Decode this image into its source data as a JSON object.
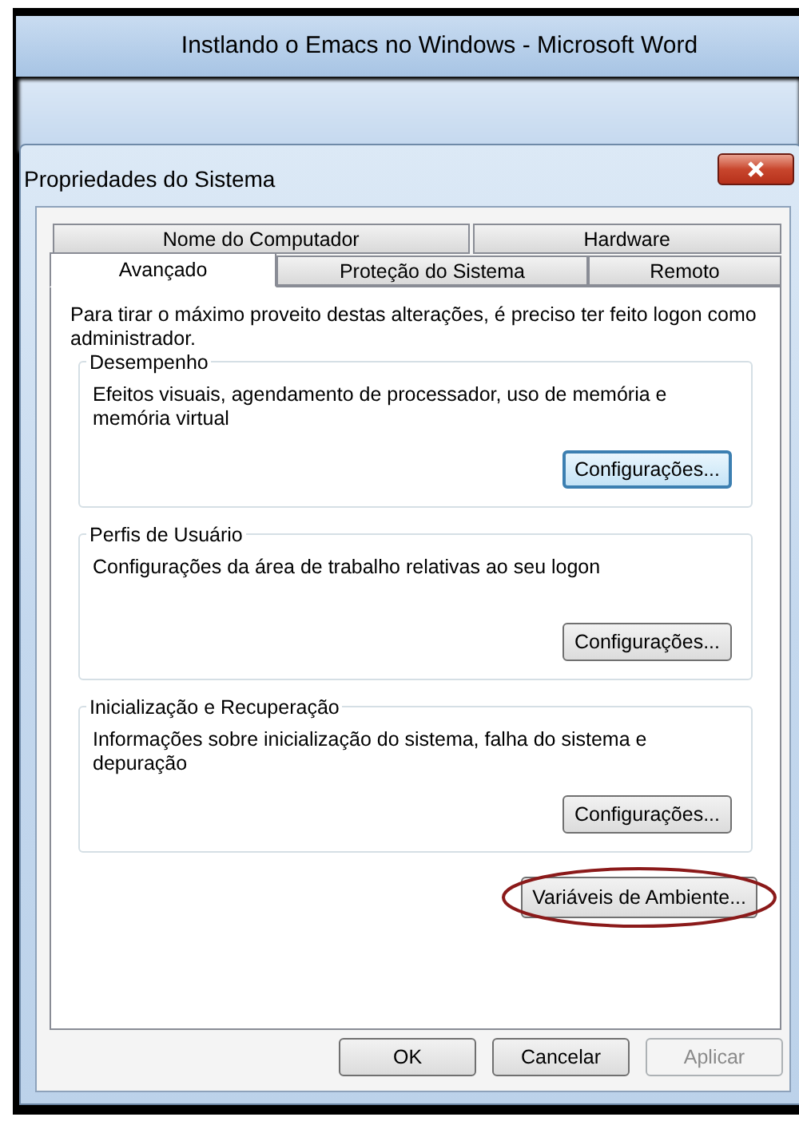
{
  "word_window": {
    "title": "Instlando o Emacs no Windows  -  Microsoft Word"
  },
  "dialog": {
    "title": "Propriedades do Sistema"
  },
  "tab_rows": [
    {
      "tabs": [
        {
          "label": "Nome do Computador",
          "selected": false
        },
        {
          "label": "Hardware",
          "selected": false
        }
      ]
    },
    {
      "tabs": [
        {
          "label": "Avançado",
          "selected": true
        },
        {
          "label": "Proteção do Sistema",
          "selected": false
        },
        {
          "label": "Remoto",
          "selected": false
        }
      ]
    }
  ],
  "notice": "Para tirar o máximo proveito destas alterações, é preciso ter feito logon como administrador.",
  "groups": [
    {
      "title": "Desempenho",
      "description": "Efeitos visuais, agendamento de processador, uso de memória e memória virtual",
      "button": {
        "label": "Configurações...",
        "focused": true
      }
    },
    {
      "title": "Perfis de Usuário",
      "description": "Configurações da área de trabalho relativas ao seu logon",
      "button": {
        "label": "Configurações...",
        "focused": false
      }
    },
    {
      "title": "Inicialização e Recuperação",
      "description": "Informações sobre inicialização do sistema, falha do sistema e depuração",
      "button": {
        "label": "Configurações...",
        "focused": false
      }
    }
  ],
  "environment_button": {
    "label": "Variáveis de Ambiente...",
    "highlighted": true
  },
  "buttons": [
    {
      "label": "OK",
      "disabled": false
    },
    {
      "label": "Cancelar",
      "disabled": false
    },
    {
      "label": "Aplicar",
      "disabled": true
    }
  ]
}
